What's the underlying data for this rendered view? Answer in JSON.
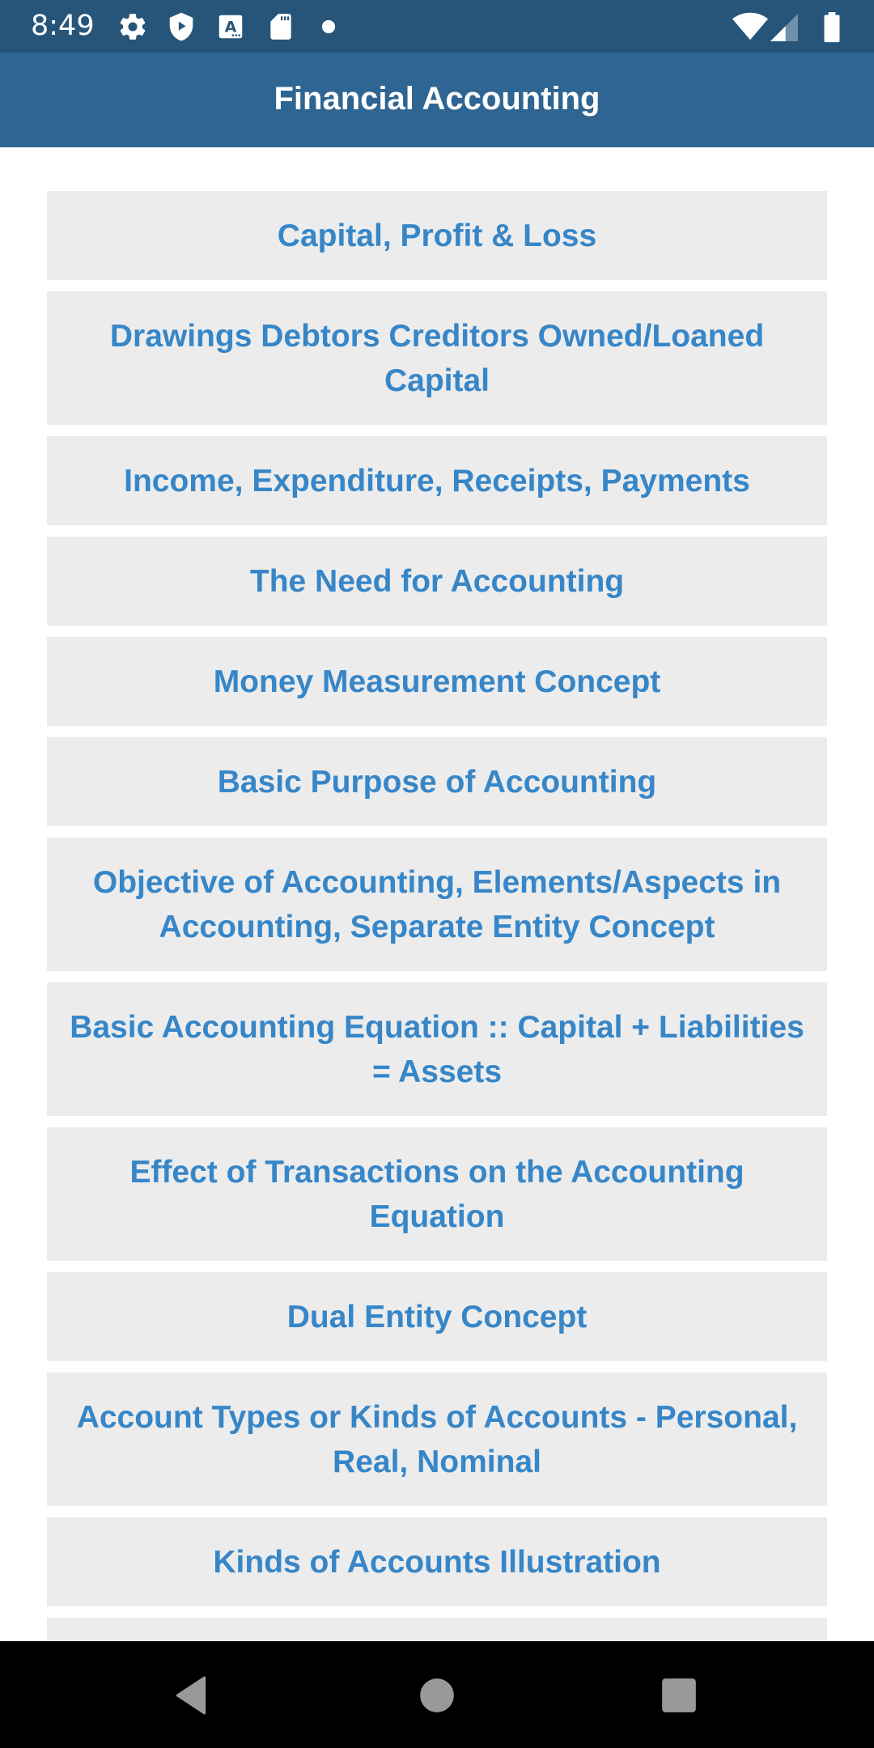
{
  "status_bar": {
    "time": "8:49",
    "left_icons": [
      "settings-gear-icon",
      "play-protect-shield-icon",
      "text-a-icon",
      "sd-card-icon",
      "notification-dot-icon"
    ],
    "right_icons": [
      "wifi-icon",
      "cell-signal-icon",
      "battery-icon"
    ]
  },
  "app_bar": {
    "title": "Financial Accounting"
  },
  "topics": [
    {
      "label": "Capital, Profit & Loss"
    },
    {
      "label": "Drawings Debtors Creditors Owned/Loaned Capital"
    },
    {
      "label": "Income, Expenditure, Receipts, Payments"
    },
    {
      "label": "The Need for Accounting"
    },
    {
      "label": "Money Measurement Concept"
    },
    {
      "label": "Basic Purpose of Accounting"
    },
    {
      "label": "Objective of Accounting, Elements/Aspects in Accounting, Separate Entity Concept"
    },
    {
      "label": "Basic Accounting Equation :: Capital + Liabilities = Assets"
    },
    {
      "label": "Effect of Transactions on the Accounting Equation"
    },
    {
      "label": "Dual Entity Concept"
    },
    {
      "label": "Account Types or Kinds of Accounts - Personal, Real, Nominal"
    },
    {
      "label": "Kinds of Accounts Illustration"
    },
    {
      "label": ""
    }
  ],
  "nav_bar": {
    "buttons": [
      "back",
      "home",
      "recents"
    ]
  }
}
